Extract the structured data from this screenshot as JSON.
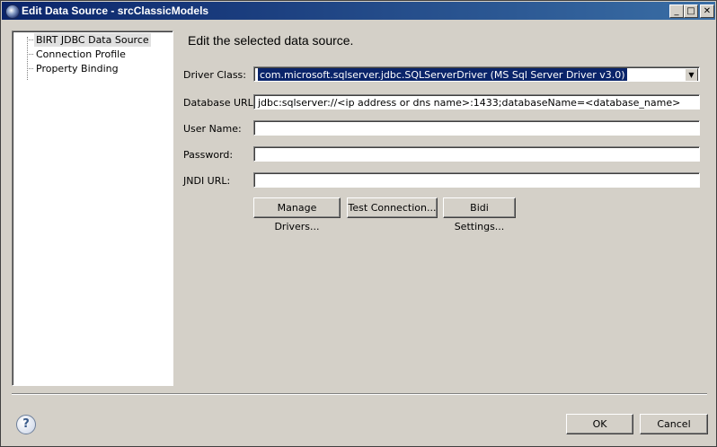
{
  "window": {
    "title": "Edit Data Source - srcClassicModels",
    "min_glyph": "_",
    "max_glyph": "□",
    "close_glyph": "✕"
  },
  "tree": {
    "items": [
      {
        "label": "BIRT JDBC Data Source"
      },
      {
        "label": "Connection Profile"
      },
      {
        "label": "Property Binding"
      }
    ]
  },
  "main": {
    "header": "Edit the selected data source.",
    "driver_class_label": "Driver Class:",
    "driver_class_value": "com.microsoft.sqlserver.jdbc.SQLServerDriver (MS Sql Server Driver v3.0)",
    "database_url_label": "Database URL:",
    "database_url_value": "jdbc:sqlserver://<ip address or dns name>:1433;databaseName=<database_name>",
    "user_name_label": "User Name:",
    "user_name_value": "",
    "password_label": "Password:",
    "password_value": "",
    "jndi_url_label": "JNDI URL:",
    "jndi_url_value": "",
    "manage_drivers": "Manage Drivers...",
    "test_connection": "Test Connection...",
    "bidi_settings": "Bidi Settings..."
  },
  "footer": {
    "help_glyph": "?",
    "ok": "OK",
    "cancel": "Cancel"
  }
}
